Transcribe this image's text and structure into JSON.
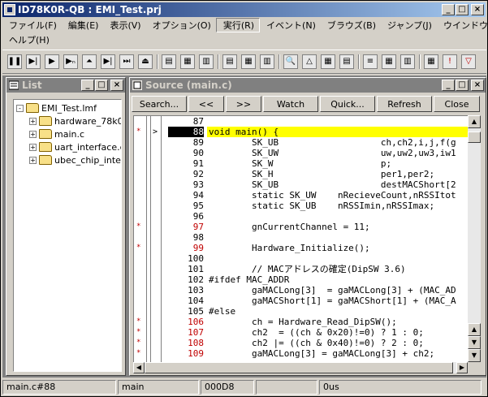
{
  "app": {
    "title": "ID78K0R-QB : EMI_Test.prj",
    "window_controls": [
      "_",
      "□",
      "×"
    ]
  },
  "menu": {
    "row1": [
      "ファイル(F)",
      "編集(E)",
      "表示(V)",
      "オプション(O)",
      "実行(R)",
      "イベント(N)",
      "ブラウズ(B)",
      "ジャンプ(J)",
      "ウインドウ(W)"
    ],
    "row2": [
      "ヘルプ(H)"
    ],
    "active_index": 4
  },
  "toolbar": {
    "icons": [
      "stop-icon",
      "run-ret-icon",
      "go-icon",
      "step-n-icon",
      "step-over-icon",
      "step-into-icon",
      "return-icon",
      "eject-icon",
      "project-icon",
      "source-icon",
      "disasm-icon",
      "memory-icon",
      "register-icon",
      "sfr-icon",
      "find-icon",
      "trace-icon",
      "event-icon",
      "stack-icon",
      "var-icon",
      "watch-icon",
      "local-icon",
      "calc-icon",
      "warn-icon",
      "break-icon"
    ]
  },
  "list_window": {
    "title": "List",
    "tree": [
      {
        "label": "EMI_Test.lmf",
        "level": 0,
        "expand": "-"
      },
      {
        "label": "hardware_78k0r.",
        "level": 1,
        "expand": "+"
      },
      {
        "label": "main.c",
        "level": 1,
        "expand": "+"
      },
      {
        "label": "uart_interface.c",
        "level": 1,
        "expand": "+"
      },
      {
        "label": "ubec_chip_interf",
        "level": 1,
        "expand": "+"
      }
    ]
  },
  "source_window": {
    "title": "Source (main.c)",
    "buttons": [
      "Search...",
      "<<",
      ">>",
      "Watch",
      "Quick...",
      "Refresh",
      "Close"
    ],
    "lines": [
      {
        "num": "87",
        "code": "",
        "bp": false,
        "red": false
      },
      {
        "num": "88",
        "code": "void main() {",
        "bp": true,
        "red": false,
        "current": true
      },
      {
        "num": "89",
        "code": "        SK_UB                   ch,ch2,i,j,f(g",
        "bp": false,
        "red": false
      },
      {
        "num": "90",
        "code": "        SK_UW                   uw,uw2,uw3,iw1",
        "bp": false,
        "red": false
      },
      {
        "num": "91",
        "code": "        SK_W                    p;",
        "bp": false,
        "red": false
      },
      {
        "num": "92",
        "code": "        SK_H                    per1,per2;",
        "bp": false,
        "red": false
      },
      {
        "num": "93",
        "code": "        SK_UB                   destMACShort[2",
        "bp": false,
        "red": false
      },
      {
        "num": "94",
        "code": "        static SK_UW    nRecieveCount,nRSSItot",
        "bp": false,
        "red": false
      },
      {
        "num": "95",
        "code": "        static SK_UB    nRSSImin,nRSSImax;",
        "bp": false,
        "red": false
      },
      {
        "num": "96",
        "code": "",
        "bp": false,
        "red": false
      },
      {
        "num": "97",
        "code": "        gnCurrentChannel = 11;",
        "bp": true,
        "red": true
      },
      {
        "num": "98",
        "code": "",
        "bp": false,
        "red": false
      },
      {
        "num": "99",
        "code": "        Hardware_Initialize();",
        "bp": true,
        "red": true
      },
      {
        "num": "100",
        "code": "",
        "bp": false,
        "red": false
      },
      {
        "num": "101",
        "code": "        // MACアドレスの確定(DipSW 3.6)",
        "bp": false,
        "red": false
      },
      {
        "num": "102",
        "code": "#ifdef MAC_ADDR",
        "bp": false,
        "red": false
      },
      {
        "num": "103",
        "code": "        gaMACLong[3]  = gaMACLong[3] + (MAC_AD",
        "bp": false,
        "red": false
      },
      {
        "num": "104",
        "code": "        gaMACShort[1] = gaMACShort[1] + (MAC_A",
        "bp": false,
        "red": false
      },
      {
        "num": "105",
        "code": "#else",
        "bp": false,
        "red": false
      },
      {
        "num": "106",
        "code": "        ch = Hardware_Read_DipSW();",
        "bp": true,
        "red": true
      },
      {
        "num": "107",
        "code": "        ch2  = ((ch & 0x20)!=0) ? 1 : 0;",
        "bp": true,
        "red": true
      },
      {
        "num": "108",
        "code": "        ch2 |= ((ch & 0x40)!=0) ? 2 : 0;",
        "bp": true,
        "red": true
      },
      {
        "num": "109",
        "code": "        gaMACLong[3] = gaMACLong[3] + ch2;",
        "bp": true,
        "red": true
      }
    ]
  },
  "status": {
    "file_pos": "main.c#88",
    "function": "main",
    "address": "000D8",
    "blank": "",
    "time": "0us"
  }
}
